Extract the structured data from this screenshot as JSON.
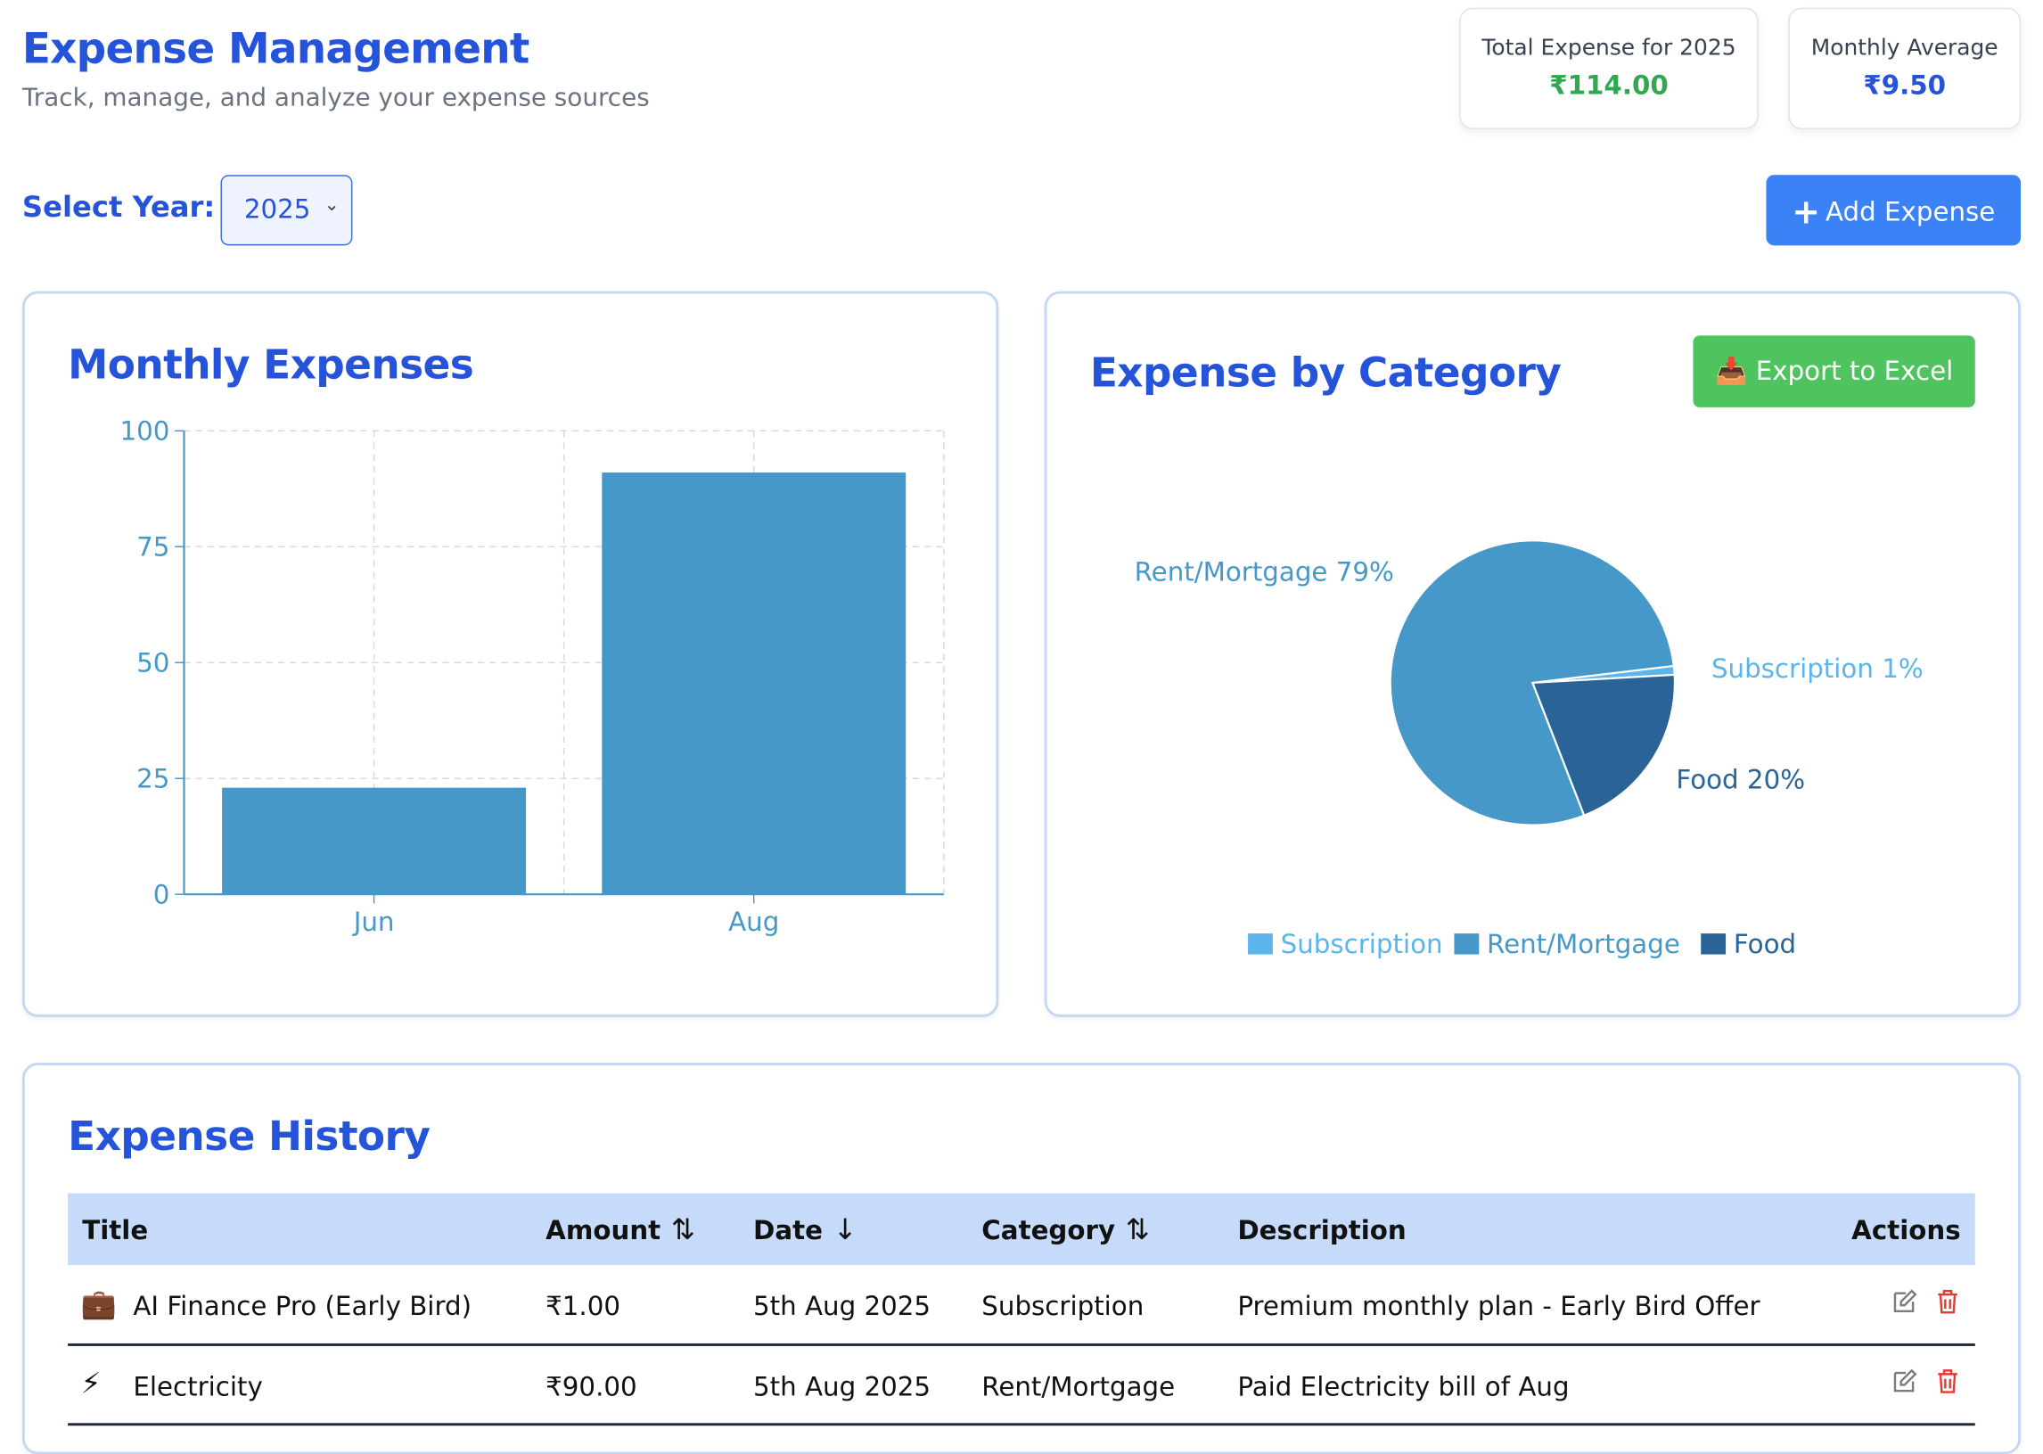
{
  "header": {
    "title": "Expense Management",
    "subtitle": "Track, manage, and analyze your expense sources"
  },
  "stats": {
    "total_label": "Total Expense for 2025",
    "total_value": "₹114.00",
    "total_color": "#2fa84f",
    "average_label": "Monthly Average",
    "average_value": "₹9.50",
    "average_color": "#2553d9"
  },
  "controls": {
    "year_label": "Select Year:",
    "year_value": "2025",
    "add_button": "Add Expense",
    "export_button": "Export to Excel"
  },
  "monthly_card": {
    "title": "Monthly Expenses"
  },
  "category_card": {
    "title": "Expense by Category"
  },
  "chart_data": [
    {
      "type": "bar",
      "categories": [
        "Jun",
        "Aug"
      ],
      "values": [
        23,
        91
      ],
      "ylim": [
        0,
        100
      ],
      "yticks": [
        0,
        25,
        50,
        75,
        100
      ],
      "grid": true,
      "color": "#4698c8"
    },
    {
      "type": "pie",
      "slices": [
        {
          "label": "Subscription",
          "value": 1,
          "percent_label": "Subscription 1%",
          "color": "#5bb4ea"
        },
        {
          "label": "Rent/Mortgage",
          "value": 79,
          "percent_label": "Rent/Mortgage 79%",
          "color": "#4698c8"
        },
        {
          "label": "Food",
          "value": 20,
          "percent_label": "Food 20%",
          "color": "#2a6496"
        }
      ],
      "legend": "bottom"
    }
  ],
  "history": {
    "title": "Expense History",
    "columns": [
      "Title",
      "Amount",
      "Date",
      "Category",
      "Description",
      "Actions"
    ],
    "rows": [
      {
        "icon": "💼",
        "title": "AI Finance Pro (Early Bird)",
        "amount": "₹1.00",
        "date": "5th Aug 2025",
        "category": "Subscription",
        "description": "Premium monthly plan - Early Bird Offer"
      },
      {
        "icon": "⚡",
        "title": "Electricity",
        "amount": "₹90.00",
        "date": "5th Aug 2025",
        "category": "Rent/Mortgage",
        "description": "Paid Electricity bill of Aug"
      }
    ]
  }
}
